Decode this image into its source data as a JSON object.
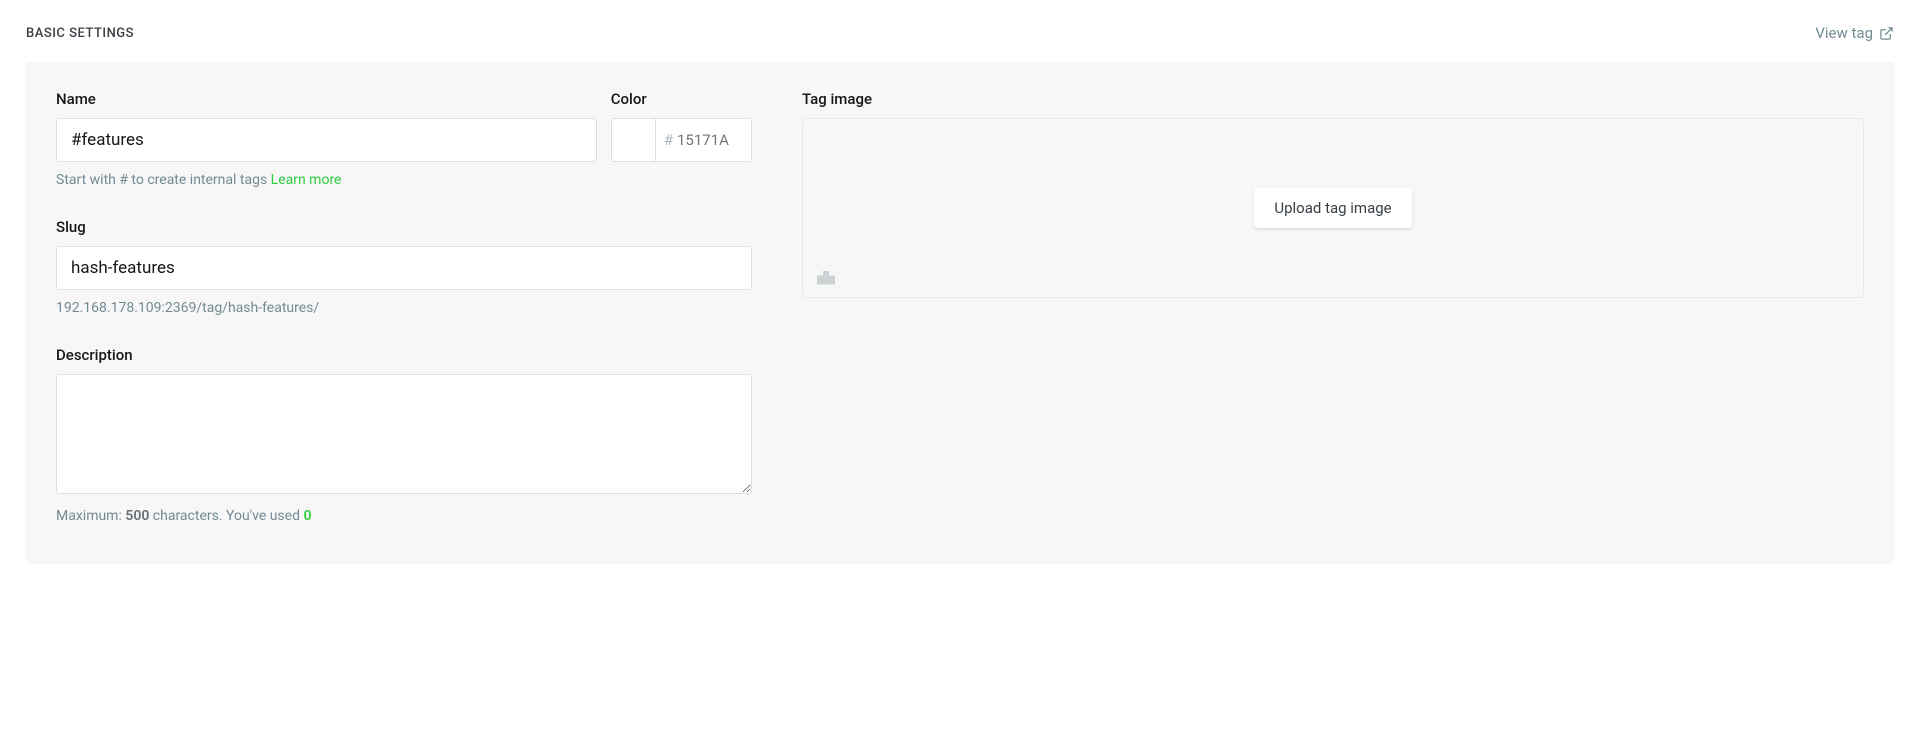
{
  "header": {
    "title": "BASIC SETTINGS",
    "view_tag_label": "View tag"
  },
  "name": {
    "label": "Name",
    "value": "#features",
    "hint_prefix": "Start with # to create internal tags ",
    "hint_link": "Learn more"
  },
  "color": {
    "label": "Color",
    "placeholder": "15171A"
  },
  "slug": {
    "label": "Slug",
    "value": "hash-features",
    "url": "192.168.178.109:2369/tag/hash-features/"
  },
  "description": {
    "label": "Description",
    "value": "",
    "hint_prefix": "Maximum: ",
    "max": "500",
    "hint_mid": " characters. You've used ",
    "used": "0"
  },
  "tag_image": {
    "label": "Tag image",
    "upload_label": "Upload tag image"
  }
}
